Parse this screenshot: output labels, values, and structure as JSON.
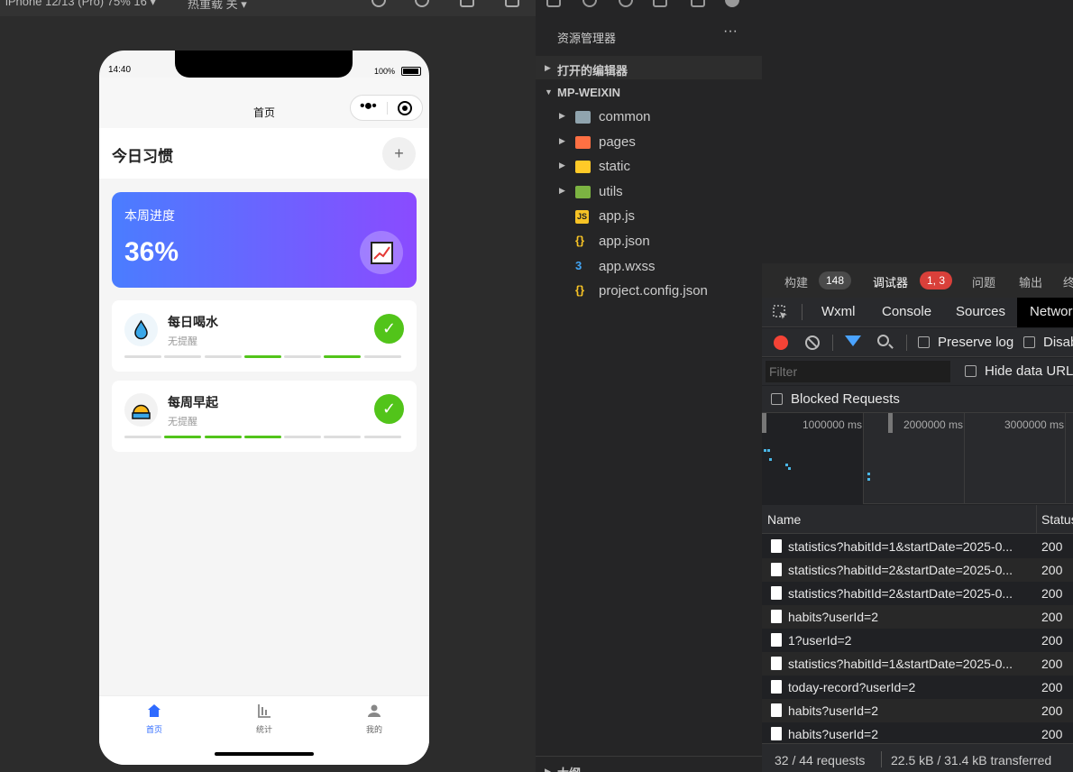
{
  "simulator": {
    "device": "iPhone 12/13 (Pro) 75% 16 ▾",
    "network": "热重载 关 ▾",
    "status_time": "14:40",
    "battery": "100%",
    "nav_title": "首页",
    "header_title": "今日习惯",
    "add_label": "+",
    "progress": {
      "title": "本周进度",
      "value": "36%"
    },
    "habits": [
      {
        "name": "每日喝水",
        "reminder": "无提醒",
        "check": "✓",
        "days_done": [
          false,
          false,
          false,
          true,
          false,
          true,
          false
        ]
      },
      {
        "name": "每周早起",
        "reminder": "无提醒",
        "check": "✓",
        "days_done": [
          false,
          true,
          true,
          true,
          false,
          false,
          false
        ]
      }
    ],
    "tabs": [
      {
        "label": "首页",
        "icon": "home-icon",
        "active": true
      },
      {
        "label": "统计",
        "icon": "stats-icon",
        "active": false
      },
      {
        "label": "我的",
        "icon": "user-icon",
        "active": false
      }
    ]
  },
  "explorer": {
    "title": "资源管理器",
    "more": "···",
    "open_editors": "打开的编辑器",
    "project": "MP-WEIXIN",
    "items": [
      {
        "label": "common",
        "type": "folder",
        "color": "#90a4ae"
      },
      {
        "label": "pages",
        "type": "folder",
        "color": "#ff7043"
      },
      {
        "label": "static",
        "type": "folder",
        "color": "#ffca28"
      },
      {
        "label": "utils",
        "type": "folder",
        "color": "#7cb342"
      },
      {
        "label": "app.js",
        "type": "js",
        "color": "#f7c325"
      },
      {
        "label": "app.json",
        "type": "json",
        "color": "#f7c325"
      },
      {
        "label": "app.wxss",
        "type": "css",
        "color": "#42a5f5"
      },
      {
        "label": "project.config.json",
        "type": "json",
        "color": "#f7c325"
      }
    ],
    "outline": "大纲"
  },
  "panel": {
    "tabs": [
      {
        "label": "构建",
        "badge": "148"
      },
      {
        "label": "调试器",
        "badge": "1, 3"
      },
      {
        "label": "问题",
        "badge": ""
      },
      {
        "label": "输出",
        "badge": ""
      },
      {
        "label": "终",
        "badge": ""
      }
    ],
    "devtools_tabs": [
      "Wxml",
      "Console",
      "Sources",
      "Network"
    ],
    "preserve_log": "Preserve log",
    "disable_cache": "Disab",
    "filter_placeholder": "Filter",
    "hide_data_urls": "Hide data URLs",
    "blocked_requests": "Blocked Requests",
    "timeline_labels": [
      "1000000 ms",
      "2000000 ms",
      "3000000 ms"
    ],
    "columns": {
      "name": "Name",
      "status": "Status"
    },
    "requests": [
      {
        "name": "statistics?habitId=1&startDate=2025-0...",
        "status": "200"
      },
      {
        "name": "statistics?habitId=2&startDate=2025-0...",
        "status": "200"
      },
      {
        "name": "statistics?habitId=2&startDate=2025-0...",
        "status": "200"
      },
      {
        "name": "habits?userId=2",
        "status": "200"
      },
      {
        "name": "1?userId=2",
        "status": "200"
      },
      {
        "name": "statistics?habitId=1&startDate=2025-0...",
        "status": "200"
      },
      {
        "name": "today-record?userId=2",
        "status": "200"
      },
      {
        "name": "habits?userId=2",
        "status": "200"
      },
      {
        "name": "habits?userId=2",
        "status": "200"
      }
    ],
    "summary": {
      "requests": "32 / 44 requests",
      "transferred": "22.5 kB / 31.4 kB transferred"
    }
  },
  "colors": {
    "accent": "#2f6bff",
    "success": "#52c41a",
    "record": "#f44336",
    "badge_error": "#d9403a"
  }
}
